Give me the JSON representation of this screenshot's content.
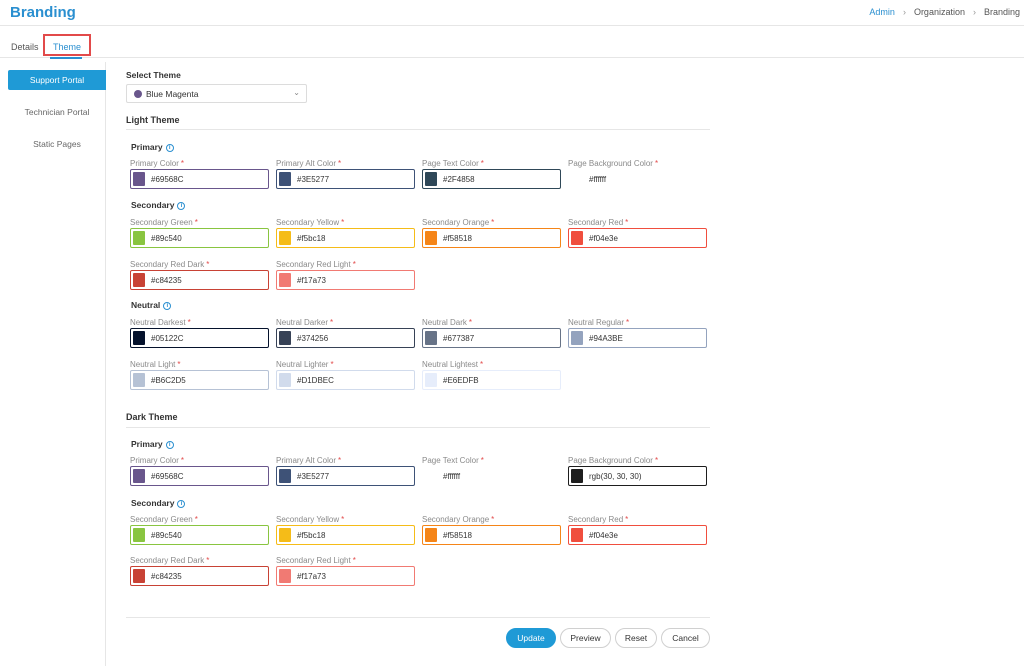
{
  "header": {
    "title": "Branding",
    "breadcrumb": [
      "Admin",
      "Organization",
      "Branding"
    ]
  },
  "tabs": [
    "Details",
    "Theme"
  ],
  "sidebar": [
    "Support Portal",
    "Technician Portal",
    "Static Pages"
  ],
  "select_theme": {
    "label": "Select Theme",
    "value": "Blue Magenta",
    "dot_color": "#69568C"
  },
  "light_theme": {
    "title": "Light Theme",
    "primary": {
      "title": "Primary",
      "fields": [
        {
          "label": "Primary Color",
          "value": "#69568C",
          "color": "#69568C"
        },
        {
          "label": "Primary Alt Color",
          "value": "#3E5277",
          "color": "#3E5277"
        },
        {
          "label": "Page Text Color",
          "value": "#2F4858",
          "color": "#2F4858"
        },
        {
          "label": "Page Background Color",
          "value": "#ffffff",
          "color": "#ffffff"
        }
      ]
    },
    "secondary": {
      "title": "Secondary",
      "fields": [
        {
          "label": "Secondary Green",
          "value": "#89c540",
          "color": "#89c540"
        },
        {
          "label": "Secondary Yellow",
          "value": "#f5bc18",
          "color": "#f5bc18"
        },
        {
          "label": "Secondary Orange",
          "value": "#f58518",
          "color": "#f58518"
        },
        {
          "label": "Secondary Red",
          "value": "#f04e3e",
          "color": "#f04e3e"
        },
        {
          "label": "Secondary Red Dark",
          "value": "#c84235",
          "color": "#c84235"
        },
        {
          "label": "Secondary Red Light",
          "value": "#f17a73",
          "color": "#f17a73"
        }
      ]
    },
    "neutral": {
      "title": "Neutral",
      "fields": [
        {
          "label": "Neutral Darkest",
          "value": "#05122C",
          "color": "#05122C"
        },
        {
          "label": "Neutral Darker",
          "value": "#374256",
          "color": "#374256"
        },
        {
          "label": "Neutral Dark",
          "value": "#677387",
          "color": "#677387"
        },
        {
          "label": "Neutral Regular",
          "value": "#94A3BE",
          "color": "#94A3BE"
        },
        {
          "label": "Neutral Light",
          "value": "#B6C2D5",
          "color": "#B6C2D5"
        },
        {
          "label": "Neutral Lighter",
          "value": "#D1DBEC",
          "color": "#D1DBEC"
        },
        {
          "label": "Neutral Lightest",
          "value": "#E6EDFB",
          "color": "#E6EDFB"
        }
      ]
    }
  },
  "dark_theme": {
    "title": "Dark Theme",
    "primary": {
      "title": "Primary",
      "fields": [
        {
          "label": "Primary Color",
          "value": "#69568C",
          "color": "#69568C"
        },
        {
          "label": "Primary Alt Color",
          "value": "#3E5277",
          "color": "#3E5277"
        },
        {
          "label": "Page Text Color",
          "value": "#ffffff",
          "color": "#ffffff"
        },
        {
          "label": "Page Background Color",
          "value": "rgb(30, 30, 30)",
          "color": "#1e1e1e"
        }
      ]
    },
    "secondary": {
      "title": "Secondary",
      "fields": [
        {
          "label": "Secondary Green",
          "value": "#89c540",
          "color": "#89c540"
        },
        {
          "label": "Secondary Yellow",
          "value": "#f5bc18",
          "color": "#f5bc18"
        },
        {
          "label": "Secondary Orange",
          "value": "#f58518",
          "color": "#f58518"
        },
        {
          "label": "Secondary Red",
          "value": "#f04e3e",
          "color": "#f04e3e"
        },
        {
          "label": "Secondary Red Dark",
          "value": "#c84235",
          "color": "#c84235"
        },
        {
          "label": "Secondary Red Light",
          "value": "#f17a73",
          "color": "#f17a73"
        }
      ]
    }
  },
  "buttons": {
    "update": "Update",
    "preview": "Preview",
    "reset": "Reset",
    "cancel": "Cancel"
  },
  "accent_color": "#1f9ad6"
}
